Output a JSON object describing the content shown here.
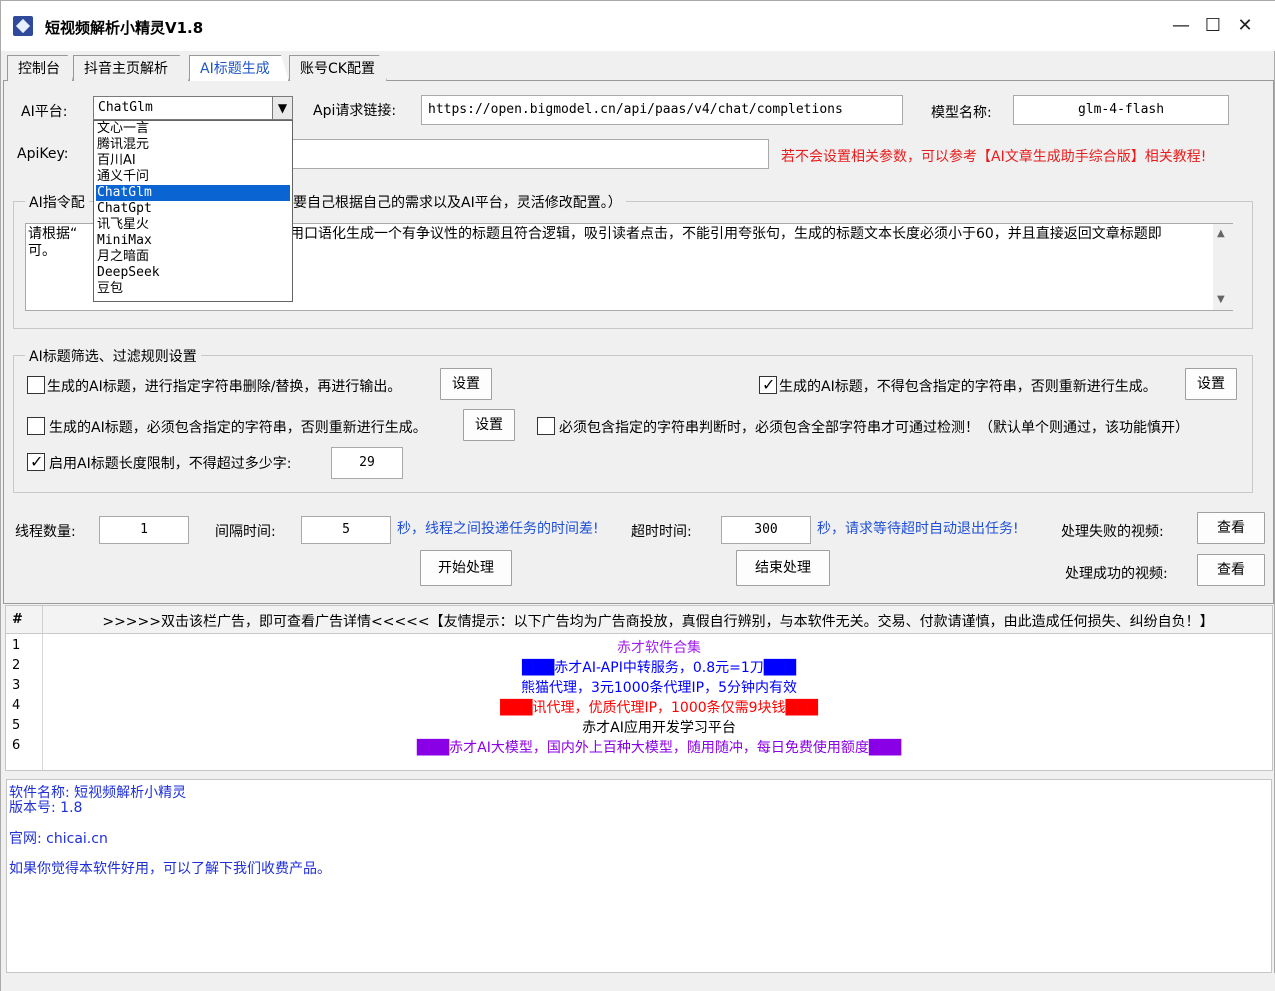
{
  "window": {
    "title": "短视频解析小精灵V1.8",
    "controls": {
      "minimize": "—",
      "maximize": "☐",
      "close": "✕"
    }
  },
  "tabs": [
    "控制台",
    "抖音主页解析",
    "AI标题生成",
    "账号CK配置"
  ],
  "active_tab": "AI标题生成",
  "config": {
    "platform_label": "AI平台:",
    "platform_value": "ChatGlm",
    "api_url_label": "Api请求链接:",
    "api_url_value": "https://open.bigmodel.cn/api/paas/v4/chat/completions",
    "model_label": "模型名称:",
    "model_value": "glm-4-flash",
    "apikey_label": "ApiKey:",
    "apikey_value": "",
    "help_text": "若不会设置相关参数，可以参考【AI文章生成助手综合版】相关教程!"
  },
  "platform_options": [
    "文心一言",
    "腾讯混元",
    "百川AI",
    "通义千问",
    "ChatGlm",
    "ChatGpt",
    "讯飞星火",
    "MiniMax",
    "月之暗面",
    "DeepSeek",
    "豆包"
  ],
  "prompt_group": {
    "title_left": "AI指令配",
    "title_right": "要自己根据自己的需求以及AI平台，灵活修改配置。）",
    "text_line1_left": "请根据“",
    "text_line1_right": "用口语化生成一个有争议性的标题且符合逻辑，吸引读者点击，不能引用夸张句，生成的标题文本长度必须小于60，并且直接返回文章标题即",
    "text_line2": "可。"
  },
  "filter_group": {
    "title": "AI标题筛选、过滤规则设置",
    "rule1": {
      "label": "生成的AI标题，进行指定字符串删除/替换，再进行输出。",
      "checked": false,
      "button": "设置"
    },
    "rule2": {
      "label": "生成的AI标题，不得包含指定的字符串，否则重新进行生成。",
      "checked": true,
      "button": "设置"
    },
    "rule3": {
      "label": "生成的AI标题，必须包含指定的字符串，否则重新进行生成。",
      "checked": false,
      "button": "设置"
    },
    "rule4": {
      "label": "必须包含指定的字符串判断时，必须包含全部字符串才可通过检测！（默认单个则通过，该功能慎开）",
      "checked": false
    },
    "rule5": {
      "label": "启用AI标题长度限制，不得超过多少字:",
      "checked": true,
      "value": "29"
    }
  },
  "run": {
    "threads_label": "线程数量:",
    "threads_value": "1",
    "interval_label": "间隔时间:",
    "interval_value": "5",
    "interval_hint": "秒，线程之间投递任务的时间差!",
    "timeout_label": "超时时间:",
    "timeout_value": "300",
    "timeout_hint": "秒，请求等待超时自动退出任务!",
    "failed_label": "处理失败的视频:",
    "failed_button": "查看",
    "success_label": "处理成功的视频:",
    "success_button": "查看",
    "start_button": "开始处理",
    "stop_button": "结束处理"
  },
  "ads": {
    "col_num": "#",
    "header": ">>>>>双击该栏广告，即可查看广告详情<<<<<【友情提示：以下广告均为广告商投放，真假自行辨别，与本软件无关。交易、付款请谨慎，由此造成任何损失、纠纷自负！】",
    "rows": [
      {
        "num": "1",
        "text": "赤才软件合集",
        "color": "#a020f0"
      },
      {
        "num": "2",
        "text": "███赤才AI-API中转服务，0.8元=1刀███",
        "color": "#0000ff"
      },
      {
        "num": "3",
        "text": "熊猫代理，3元1000条代理IP，5分钟内有效",
        "color": "#0000ff"
      },
      {
        "num": "4",
        "text": "███讯代理，优质代理IP，1000条仅需9块钱███",
        "color": "#ff0000"
      },
      {
        "num": "5",
        "text": "赤才AI应用开发学习平台",
        "color": "#000000"
      },
      {
        "num": "6",
        "text": "███赤才AI大模型，国内外上百种大模型，随用随冲，每日免费使用额度███",
        "color": "#8a00e6"
      }
    ]
  },
  "log": {
    "line1": "软件名称: 短视频解析小精灵",
    "line2": "版本号: 1.8",
    "line3": "官网: chicai.cn",
    "line4": "如果你觉得本软件好用，可以了解下我们收费产品。"
  }
}
